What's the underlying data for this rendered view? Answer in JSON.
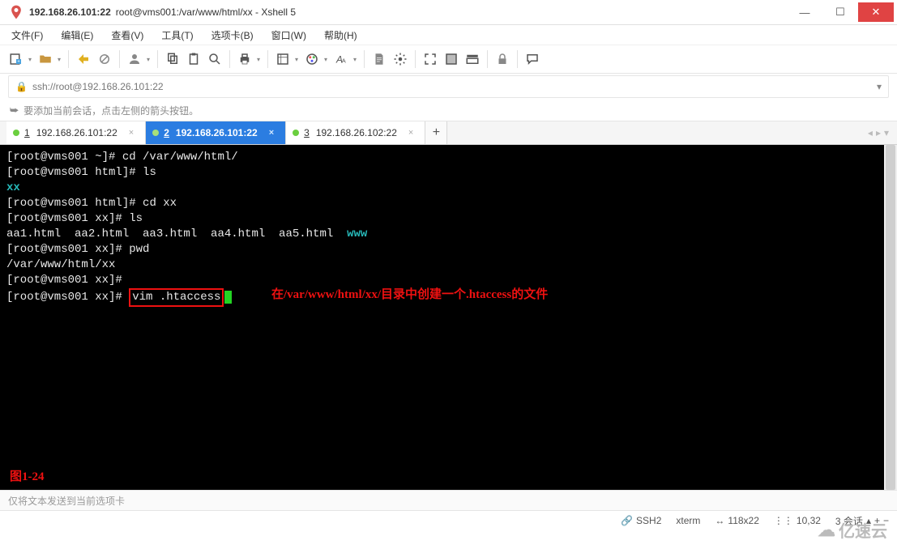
{
  "titlebar": {
    "ip_title": "192.168.26.101:22",
    "full_title": "root@vms001:/var/www/html/xx - Xshell 5"
  },
  "menubar": {
    "items": [
      {
        "label": "文件(F)"
      },
      {
        "label": "编辑(E)"
      },
      {
        "label": "查看(V)"
      },
      {
        "label": "工具(T)"
      },
      {
        "label": "选项卡(B)"
      },
      {
        "label": "窗口(W)"
      },
      {
        "label": "帮助(H)"
      }
    ]
  },
  "address": {
    "url": "ssh://root@192.168.26.101:22"
  },
  "hint": {
    "text": "要添加当前会话，点击左侧的箭头按钮。"
  },
  "tabs": {
    "items": [
      {
        "num": "1",
        "label": "192.168.26.101:22",
        "active": false
      },
      {
        "num": "2",
        "label": "192.168.26.101:22",
        "active": true
      },
      {
        "num": "3",
        "label": "192.168.26.102:22",
        "active": false
      }
    ]
  },
  "terminal": {
    "lines": [
      {
        "prompt": "[root@vms001 ~]#",
        "cmd": " cd /var/www/html/"
      },
      {
        "prompt": "[root@vms001 html]#",
        "cmd": " ls"
      },
      {
        "out_dir": "xx"
      },
      {
        "prompt": "[root@vms001 html]#",
        "cmd": " cd xx"
      },
      {
        "prompt": "[root@vms001 xx]#",
        "cmd": " ls"
      },
      {
        "listing_white": "aa1.html  aa2.html  aa3.html  aa4.html  aa5.html  ",
        "listing_dir": "www"
      },
      {
        "prompt": "[root@vms001 xx]#",
        "cmd": " pwd"
      },
      {
        "out": "/var/www/html/xx"
      },
      {
        "prompt": "[root@vms001 xx]#",
        "cmd": ""
      },
      {
        "prompt": "[root@vms001 xx]#",
        "boxed_cmd": "vim .htaccess"
      }
    ],
    "annotation": "在/var/www/html/xx/目录中创建一个.htaccess的文件",
    "figure_label": "图1-24"
  },
  "multiwrite": {
    "text": "仅将文本发送到当前选项卡"
  },
  "statusbar": {
    "proto": "SSH2",
    "term": "xterm",
    "size": "118x22",
    "pos": "10,32",
    "sessions": "3 会话"
  },
  "watermark": {
    "text": "亿速云"
  }
}
